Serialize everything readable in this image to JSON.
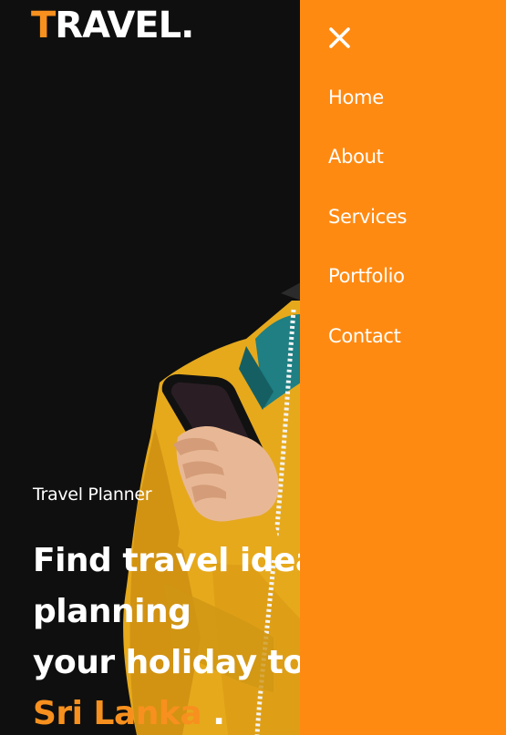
{
  "logo": {
    "first_letter": "T",
    "rest": "RAVEL."
  },
  "hero": {
    "subtitle": "Travel Planner",
    "title_line1": "Find travel idea",
    "title_line2": "planning",
    "title_line3": "your holiday to",
    "destination": "Sri Lanka",
    "destination_suffix": " ."
  },
  "menu": {
    "items": [
      {
        "label": "Home"
      },
      {
        "label": "About"
      },
      {
        "label": "Services"
      },
      {
        "label": "Portfolio"
      },
      {
        "label": "Contact"
      }
    ]
  },
  "colors": {
    "accent": "#f7901e",
    "menu_background": "#ff8a12",
    "page_background": "#0f0f0f",
    "text": "#ffffff"
  },
  "icons": {
    "close": "close-icon"
  }
}
